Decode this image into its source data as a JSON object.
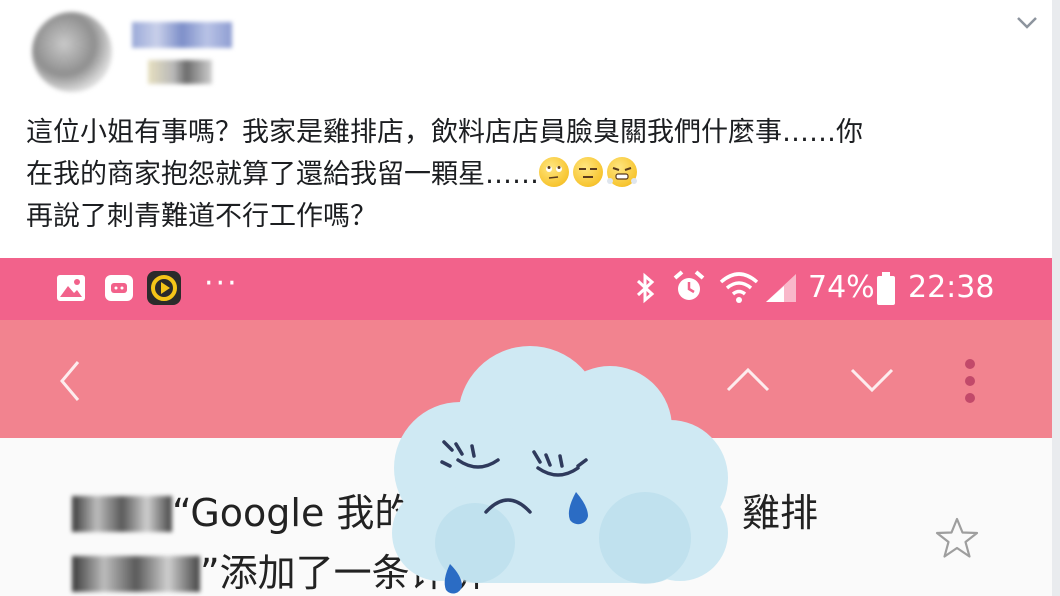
{
  "post": {
    "text_lines": [
      "這位小姐有事嗎？我家是雞排店，飲料店店員臉臭關我們什麼事……你",
      "在我的商家抱怨就算了還給我留一顆星……",
      "再說了刺青難道不行工作嗎？"
    ],
    "emojis": [
      "rolling-eyes-emoji",
      "expressionless-emoji",
      "triumph-emoji"
    ]
  },
  "phone": {
    "status_bar": {
      "ellipsis": "···",
      "battery": "74%",
      "time": "22:38",
      "color": "#f2628b"
    },
    "nav_bar": {
      "color": "#f2838f"
    },
    "notification": {
      "line1_visible": "“Google 我的",
      "line1_end": "雞排",
      "line2": "”添加了一条评价"
    }
  },
  "overlay": {
    "sticker": "crying-cloud-sticker"
  }
}
